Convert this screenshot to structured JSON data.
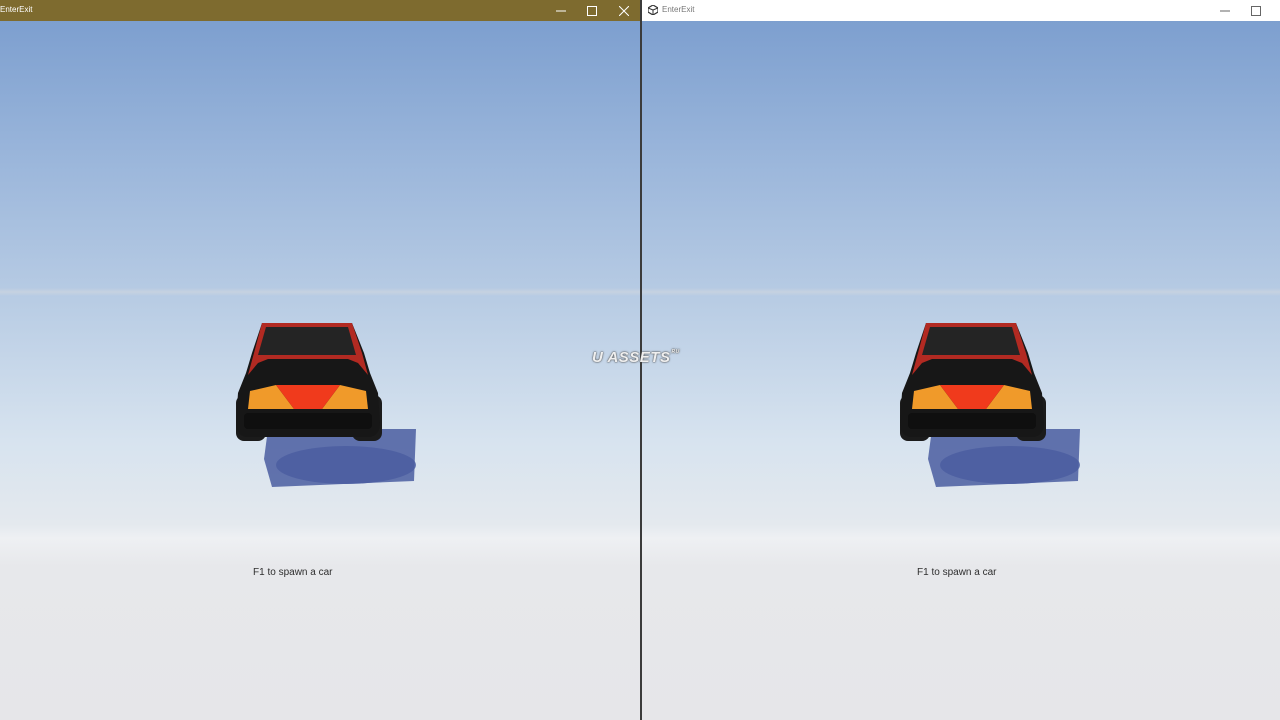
{
  "windows": [
    {
      "title": "EnterExit",
      "hint_text": "F1 to spawn a car",
      "title_bar_color": "#7e6b2f",
      "controls": [
        "minimize-icon",
        "maximize-icon",
        "close-icon"
      ]
    },
    {
      "title": "EnterExit",
      "hint_text": "F1 to spawn a car",
      "title_bar_color": "#ffffff",
      "controls": [
        "unity-logo-icon",
        "minimize-icon",
        "maximize-icon"
      ]
    }
  ],
  "watermark": {
    "main": "U ASSETS",
    "sup": "RU"
  },
  "colors": {
    "sky_top": "#7d9fcf",
    "ground": "#e6e6e9",
    "car_body": "#1a1a1a",
    "car_accent": "#d23024",
    "taillight_orange": "#f09a2a",
    "taillight_red": "#f03a1c"
  }
}
